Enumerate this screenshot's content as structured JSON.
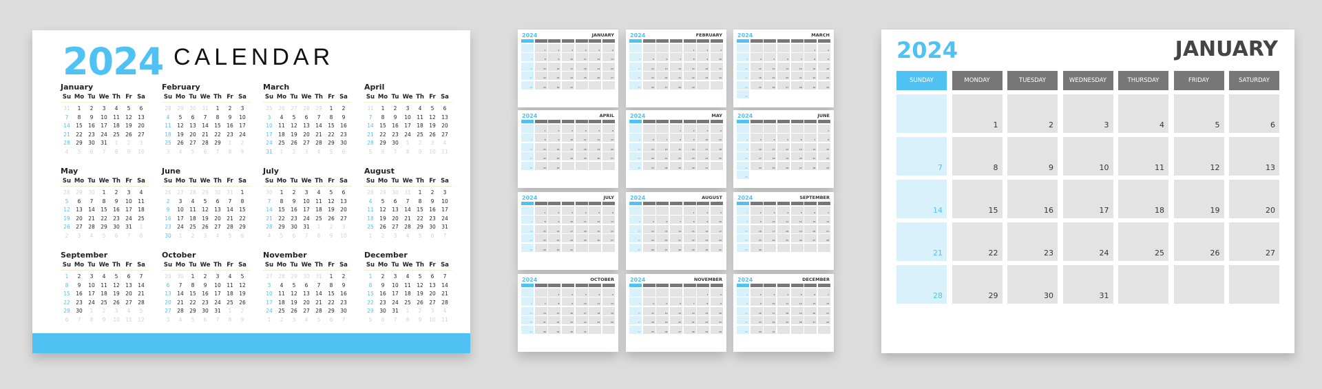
{
  "colors": {
    "accent": "#4fc1f3",
    "header_gray": "#777777",
    "cell_gray": "#e3e3e3",
    "sunday_cell": "#d9f1fb"
  },
  "year": "2024",
  "left": {
    "title": "CALENDAR"
  },
  "weekdays_short": [
    "Su",
    "Mo",
    "Tu",
    "We",
    "Th",
    "Fr",
    "Sa"
  ],
  "weekdays_long": [
    "SUNDAY",
    "MONDAY",
    "TUESDAY",
    "WEDNESDAY",
    "THURSDAY",
    "FRIDAY",
    "SATURDAY"
  ],
  "months": [
    {
      "name": "January",
      "upper": "JANUARY",
      "first_weekday": 1,
      "days": 31
    },
    {
      "name": "February",
      "upper": "FEBRUARY",
      "first_weekday": 4,
      "days": 29
    },
    {
      "name": "March",
      "upper": "MARCH",
      "first_weekday": 5,
      "days": 31
    },
    {
      "name": "April",
      "upper": "APRIL",
      "first_weekday": 1,
      "days": 30
    },
    {
      "name": "May",
      "upper": "MAY",
      "first_weekday": 3,
      "days": 31
    },
    {
      "name": "June",
      "upper": "JUNE",
      "first_weekday": 6,
      "days": 30
    },
    {
      "name": "July",
      "upper": "JULY",
      "first_weekday": 1,
      "days": 31
    },
    {
      "name": "August",
      "upper": "AUGUST",
      "first_weekday": 4,
      "days": 31
    },
    {
      "name": "September",
      "upper": "SEPTEMBER",
      "first_weekday": 0,
      "days": 30
    },
    {
      "name": "October",
      "upper": "OCTOBER",
      "first_weekday": 2,
      "days": 31
    },
    {
      "name": "November",
      "upper": "NOVEMBER",
      "first_weekday": 5,
      "days": 30
    },
    {
      "name": "December",
      "upper": "DECEMBER",
      "first_weekday": 0,
      "days": 31
    }
  ],
  "prev_december_days": 31,
  "right": {
    "month_index": 0
  }
}
